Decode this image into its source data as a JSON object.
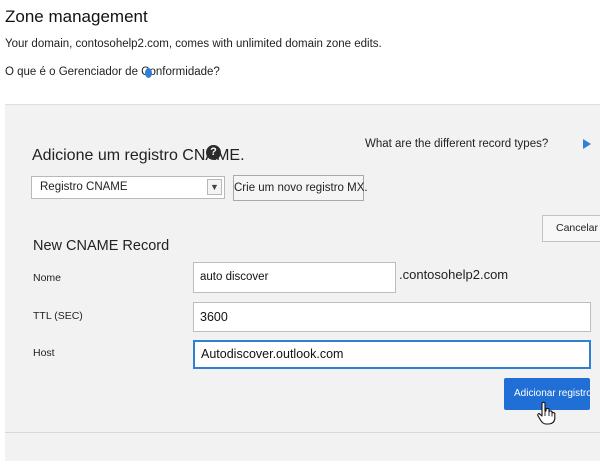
{
  "header": {
    "title": "Zone management",
    "description": "Your domain, contosohelp2.com, comes with unlimited domain zone edits.",
    "compliance_link": "O que é o Gerenciador de Conformidade?"
  },
  "section": {
    "title": "Adicione um registro CNAME.",
    "help_glyph": "?",
    "record_types_link": "What are the different record types?"
  },
  "controls": {
    "record_type_selected": "Registro CNAME",
    "new_record_button": "Crie um novo registro MX.",
    "cancel_button": "Cancelar"
  },
  "form": {
    "title": "New CNAME Record",
    "name_label": "Nome",
    "name_value": "auto discover",
    "domain_suffix": ".contosohelp2.com",
    "ttl_label": "TTL (SEC)",
    "ttl_value": "3600",
    "host_label": "Host",
    "host_value": "Autodiscover.outlook.com",
    "submit_button": "Adicionar registro"
  },
  "icons": {
    "help": "help-icon",
    "play": "play-arrow-icon",
    "dropdown": "chevron-down-icon",
    "cursor": "hand-cursor-icon"
  },
  "colors": {
    "accent": "#1f6fd6",
    "focus_border": "#2f7fd6",
    "panel_bg": "#f2f2f2"
  }
}
